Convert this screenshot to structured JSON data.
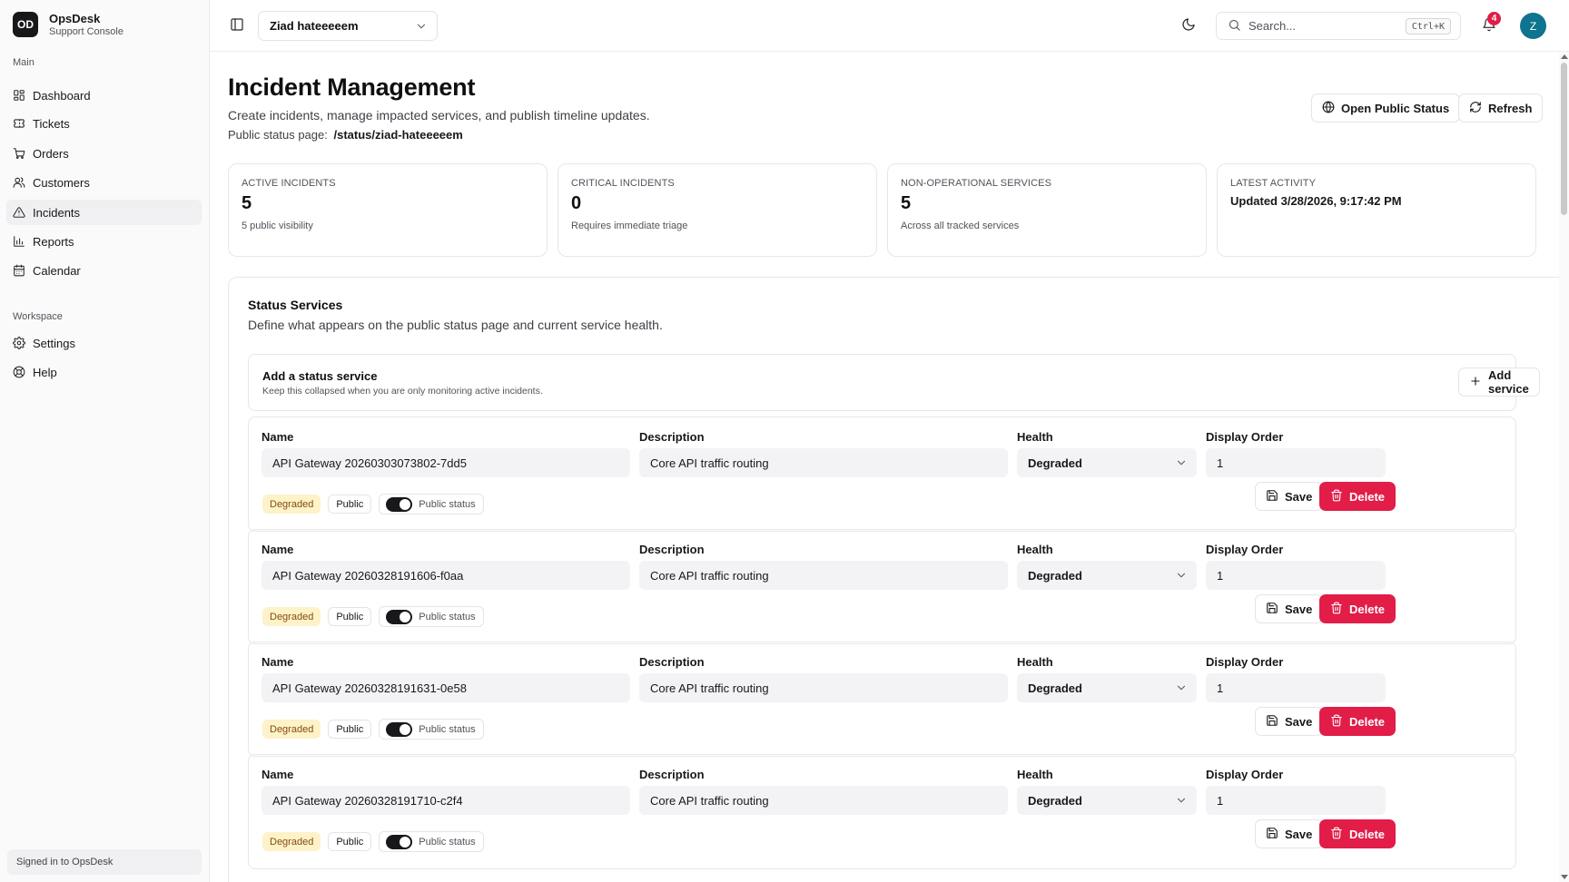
{
  "brand": {
    "logo": "OD",
    "name": "OpsDesk",
    "subtitle": "Support Console"
  },
  "sidebar": {
    "groups": [
      {
        "label": "Main",
        "items": [
          {
            "label": "Dashboard",
            "icon": "dashboard-icon"
          },
          {
            "label": "Tickets",
            "icon": "ticket-icon"
          },
          {
            "label": "Orders",
            "icon": "cart-icon"
          },
          {
            "label": "Customers",
            "icon": "users-icon"
          },
          {
            "label": "Incidents",
            "icon": "alert-triangle-icon",
            "active": true
          },
          {
            "label": "Reports",
            "icon": "bar-chart-icon"
          },
          {
            "label": "Calendar",
            "icon": "calendar-icon"
          }
        ]
      },
      {
        "label": "Workspace",
        "items": [
          {
            "label": "Settings",
            "icon": "gear-icon"
          },
          {
            "label": "Help",
            "icon": "help-icon"
          }
        ]
      }
    ],
    "footer": "Signed in to OpsDesk"
  },
  "header": {
    "workspace": "Ziad hateeeeem",
    "search_placeholder": "Search...",
    "search_shortcut": "Ctrl+K",
    "notification_count": "4",
    "avatar_initial": "Z"
  },
  "page": {
    "title": "Incident Management",
    "description": "Create incidents, manage impacted services, and publish timeline updates.",
    "status_label": "Public status page:",
    "status_path": "/status/ziad-hateeeeem",
    "open_status_label": "Open Public Status",
    "refresh_label": "Refresh"
  },
  "stats": [
    {
      "label": "Active incidents",
      "value": "5",
      "note": "5 public visibility"
    },
    {
      "label": "Critical incidents",
      "value": "0",
      "note": "Requires immediate triage"
    },
    {
      "label": "Non-operational services",
      "value": "5",
      "note": "Across all tracked services"
    },
    {
      "label": "Latest activity",
      "value": "Updated 3/28/2026, 9:17:42 PM"
    }
  ],
  "status_services": {
    "title": "Status Services",
    "description": "Define what appears on the public status page and current service health.",
    "add": {
      "title": "Add a status service",
      "note": "Keep this collapsed when you are only monitoring active incidents.",
      "button": "Add service"
    },
    "labels": {
      "name": "Name",
      "description": "Description",
      "health": "Health",
      "order": "Display Order",
      "public_chip": "Public",
      "public_toggle": "Public status",
      "save": "Save",
      "delete": "Delete"
    },
    "services": [
      {
        "name": "API Gateway 20260303073802-7dd5",
        "description": "Core API traffic routing",
        "health": "Degraded",
        "order": "1"
      },
      {
        "name": "API Gateway 20260328191606-f0aa",
        "description": "Core API traffic routing",
        "health": "Degraded",
        "order": "1"
      },
      {
        "name": "API Gateway 20260328191631-0e58",
        "description": "Core API traffic routing",
        "health": "Degraded",
        "order": "1"
      },
      {
        "name": "API Gateway 20260328191710-c2f4",
        "description": "Core API traffic routing",
        "health": "Degraded",
        "order": "1"
      }
    ]
  },
  "colors": {
    "primary": "#18181b",
    "danger": "#e11d48",
    "degraded_bg": "#fdf2c8",
    "degraded_text": "#854d0e",
    "avatar": "#0e7490"
  }
}
